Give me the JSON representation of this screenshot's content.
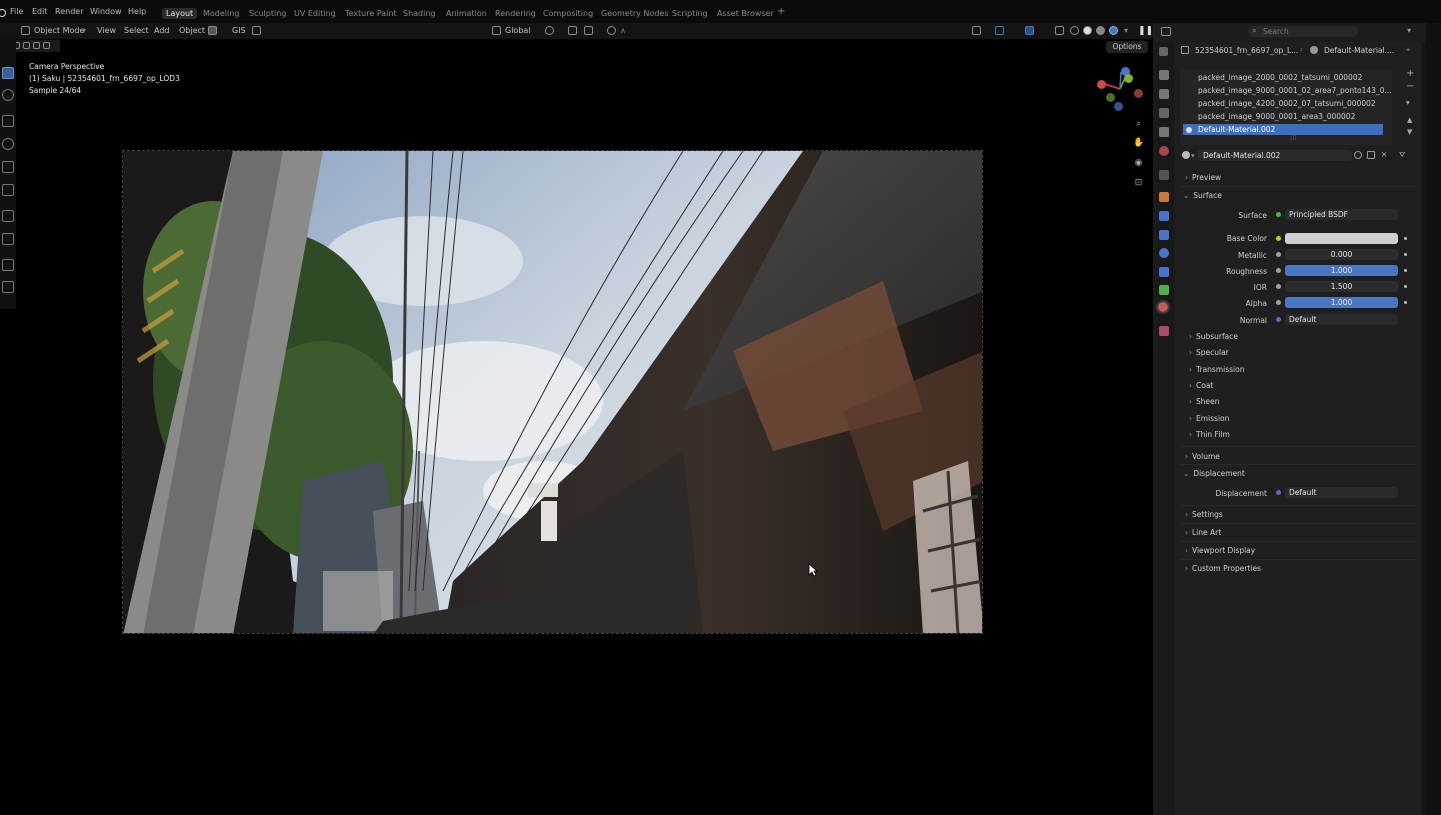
{
  "menu": {
    "items": [
      "File",
      "Edit",
      "Render",
      "Window",
      "Help"
    ],
    "workspaces": [
      "Layout",
      "Modeling",
      "Sculpting",
      "UV Editing",
      "Texture Paint",
      "Shading",
      "Animation",
      "Rendering",
      "Compositing",
      "Geometry Nodes",
      "Scripting",
      "Asset Browser"
    ],
    "active_workspace": "Layout",
    "add_tab": "+"
  },
  "viewport_header": {
    "mode": "Object Mode",
    "menus": [
      "View",
      "Select",
      "Add",
      "Object",
      "GIS"
    ],
    "transform_orientation": "Global",
    "options": "Options"
  },
  "overlay": {
    "view_name": "Camera Perspective",
    "object_info": "(1) Saku | 52354601_frn_6697_op_LOD3",
    "sample": "Sample 24/64"
  },
  "properties": {
    "search_placeholder": "Search",
    "breadcrumb_object": "52354601_frn_6697_op_L...",
    "breadcrumb_material": "Default-Material....",
    "material_slots": [
      "packed_image_2000_0002_tatsumi_000002",
      "packed_image_9000_0001_02_area7_ponto143_0...",
      "packed_image_4200_0002_07_tatsumi_000002",
      "packed_image_9000_0001_area3_000002",
      "Default-Material.002"
    ],
    "selected_slot_index": 4,
    "material_name": "Default-Material.002",
    "sections": {
      "preview": "Preview",
      "surface": "Surface",
      "volume": "Volume",
      "displacement": "Displacement",
      "settings": "Settings",
      "line_art": "Line Art",
      "viewport_display": "Viewport Display",
      "custom_properties": "Custom Properties"
    },
    "surface": {
      "surface_label": "Surface",
      "surface_value": "Principled BSDF",
      "base_color_label": "Base Color",
      "base_color": "#cfcfcf",
      "metallic_label": "Metallic",
      "metallic": "0.000",
      "roughness_label": "Roughness",
      "roughness": "1.000",
      "roughness_fill": 1.0,
      "ior_label": "IOR",
      "ior": "1.500",
      "alpha_label": "Alpha",
      "alpha": "1.000",
      "alpha_fill": 1.0,
      "normal_label": "Normal",
      "normal_value": "Default"
    },
    "subsections": [
      "Subsurface",
      "Specular",
      "Transmission",
      "Coat",
      "Sheen",
      "Emission",
      "Thin Film"
    ],
    "displacement": {
      "label": "Displacement",
      "value": "Default"
    }
  },
  "colors": {
    "accent_blue": "#3d6fbf",
    "socket_yellow": "#c7c729",
    "socket_grey": "#a1a1a1",
    "socket_purple": "#6363c7"
  }
}
